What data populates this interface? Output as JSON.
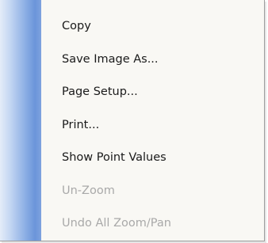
{
  "menu": {
    "items": [
      {
        "label": "Copy",
        "enabled": true
      },
      {
        "label": "Save Image As...",
        "enabled": true
      },
      {
        "label": "Page Setup...",
        "enabled": true
      },
      {
        "label": "Print...",
        "enabled": true
      },
      {
        "label": "Show Point Values",
        "enabled": true
      },
      {
        "label": "Un-Zoom",
        "enabled": false
      },
      {
        "label": "Undo All Zoom/Pan",
        "enabled": false
      }
    ]
  },
  "colors": {
    "menu_background": "#f9f8f4",
    "gutter_accent": "#6b95da",
    "text_enabled": "#1a1a1a",
    "text_disabled": "#a9a9a9"
  }
}
